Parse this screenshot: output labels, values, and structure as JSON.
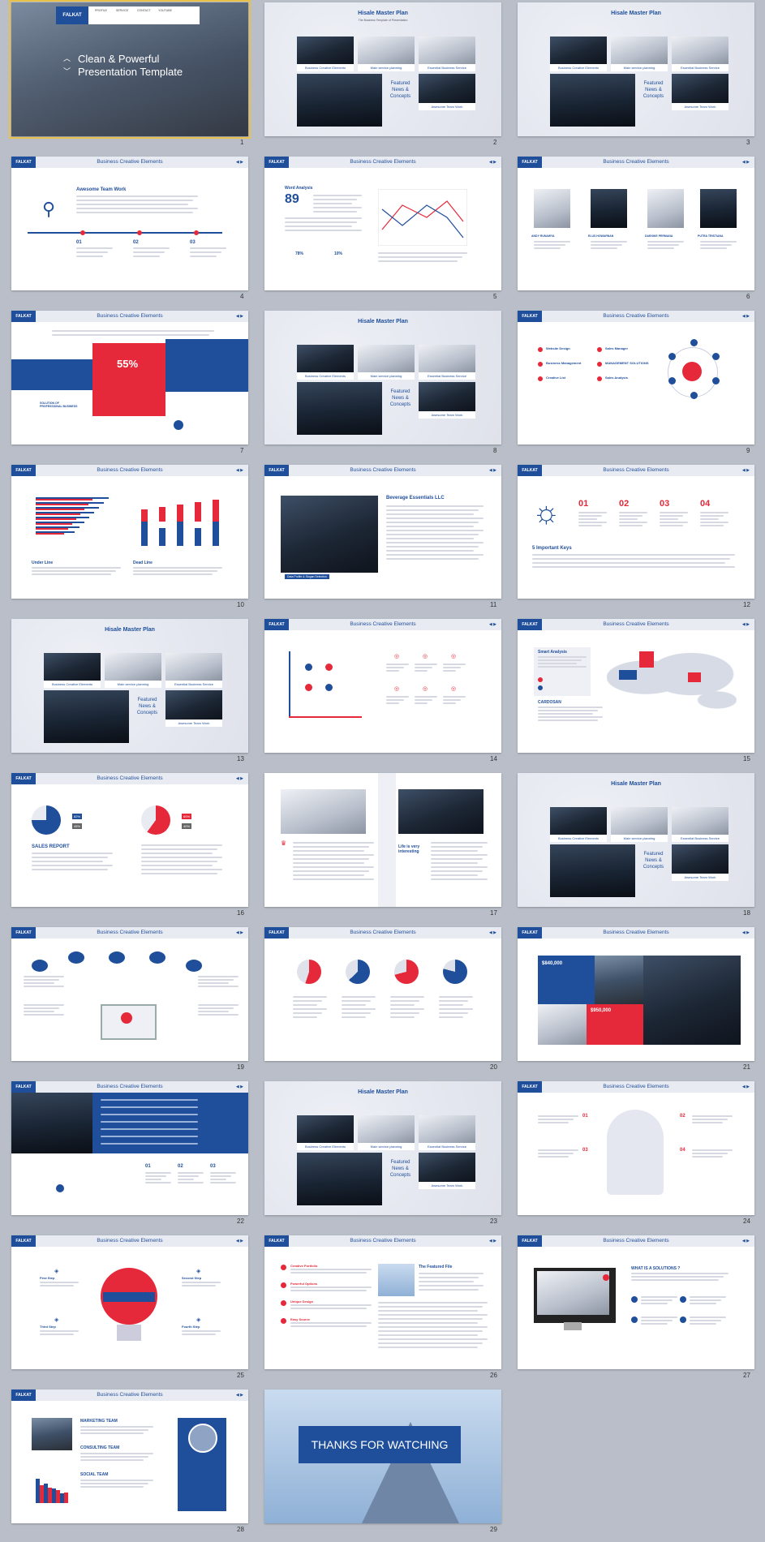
{
  "slides": [
    {
      "number": "1",
      "cover_title": "Clean & Powerful\nPresentation Template",
      "logo": "FALKAT",
      "nav": [
        "PROFILE",
        "SERVICE",
        "CONTACT",
        "YOUTUBE"
      ]
    },
    {
      "number": "2",
      "title": "Hisale Master Plan",
      "subtitle": "The Business Template of Presentation",
      "captions": [
        "Business Creative Elements",
        "Main service planning",
        "Essential Business Service",
        "Awesome Team Work"
      ],
      "featured": "Featured\nNews &\nConcepts"
    },
    {
      "number": "3",
      "title": "Hisale Master Plan",
      "captions": [
        "Business Creative Elements",
        "Main service planning",
        "Essential Business Service",
        "Awesome Team Work"
      ],
      "featured": "Featured\nNews &\nConcepts"
    },
    {
      "number": "4",
      "header": "Business Creative Elements",
      "heading": "Awesome Team Work",
      "steps": [
        "01",
        "02",
        "03"
      ]
    },
    {
      "number": "5",
      "header": "Business Creative Elements",
      "heading": "Word Analysis",
      "big": "89",
      "pct": [
        "78%",
        "10%"
      ]
    },
    {
      "number": "6",
      "header": "Business Creative Elements",
      "names": [
        "ANDY RUNAWYA",
        "ELUS HOWARNAN",
        "DAENIKE PERMANA",
        "PUTRA TRISTIANA"
      ]
    },
    {
      "number": "7",
      "header": "Business Creative Elements",
      "big": "55%",
      "side": "SOLUTION OF PROFESSIONAL BUSINESS"
    },
    {
      "number": "8",
      "title": "Hisale Master Plan",
      "captions": [
        "Business Creative Elements",
        "Main service planning",
        "Essential Business Service",
        "Awesome Team Work"
      ],
      "featured": "Featured\nNews &\nConcepts"
    },
    {
      "number": "9",
      "header": "Business Creative Elements",
      "items": [
        "Website Design",
        "Business Management",
        "Creative List",
        "Sales Manager",
        "MANAGEMENT SOLUTIONS",
        "Sales Analysis"
      ]
    },
    {
      "number": "10",
      "header": "Business Creative Elements",
      "labels": [
        "Under Line",
        "Dead Line"
      ]
    },
    {
      "number": "11",
      "header": "Business Creative Elements",
      "heading": "Beverage Essentials LLC",
      "caption": "Data Profile & Slogan Selection"
    },
    {
      "number": "12",
      "header": "Business Creative Elements",
      "nums": [
        "01",
        "02",
        "03",
        "04"
      ],
      "heading": "5 Important Keys"
    },
    {
      "number": "13",
      "title": "Hisale Master Plan",
      "captions": [
        "Business Creative Elements",
        "Main service planning",
        "Essential Business Service",
        "Awesome Team Work"
      ],
      "featured": "Featured\nNews &\nConcepts"
    },
    {
      "number": "14",
      "header": "Business Creative Elements"
    },
    {
      "number": "15",
      "header": "Business Creative Elements",
      "heading": "Smart Analysis",
      "sub": "CARDOSAN"
    },
    {
      "number": "16",
      "header": "Business Creative Elements",
      "heading": "SALES REPORT",
      "pcts": [
        "82%",
        "45%",
        "60%",
        "40%"
      ]
    },
    {
      "number": "17",
      "side": "Life is very interesting"
    },
    {
      "number": "18",
      "title": "Hisale Master Plan",
      "captions": [
        "Business Creative Elements",
        "Main service planning",
        "Essential Business Service",
        "Awesome Team Work"
      ],
      "featured": "Featured\nNews &\nConcepts"
    },
    {
      "number": "19",
      "header": "Business Creative Elements"
    },
    {
      "number": "20",
      "header": "Business Creative Elements"
    },
    {
      "number": "21",
      "header": "Business Creative Elements",
      "values": [
        "$840,000",
        "$950,000"
      ]
    },
    {
      "number": "22",
      "header": "Business Creative Elements",
      "steps": [
        "01",
        "02",
        "03"
      ]
    },
    {
      "number": "23",
      "title": "Hisale Master Plan",
      "captions": [
        "Business Creative Elements",
        "Main service planning",
        "Essential Business Service",
        "Awesome Team Work"
      ],
      "featured": "Featured\nNews &\nConcepts"
    },
    {
      "number": "24",
      "header": "Business Creative Elements",
      "nums": [
        "01",
        "02",
        "03",
        "04"
      ]
    },
    {
      "number": "25",
      "header": "Business Creative Elements",
      "steps": [
        "First Step",
        "Second Step",
        "Third Step",
        "Fourth Step"
      ]
    },
    {
      "number": "26",
      "header": "Business Creative Elements",
      "heading": "The Featured File",
      "items": [
        "Creative Portfolio",
        "Powerful Options",
        "Unique Design",
        "Easy Source"
      ]
    },
    {
      "number": "27",
      "header": "Business Creative Elements",
      "heading": "WHAT IS A SOLUTIONS ?"
    },
    {
      "number": "28",
      "header": "Business Creative Elements",
      "teams": [
        "MARKETING TEAM",
        "CONSULTING TEAM",
        "SOCIAL TEAM"
      ]
    },
    {
      "number": "29",
      "thanks": "THANKS FOR WATCHING"
    }
  ],
  "colors": {
    "accent": "#1f4e9b",
    "red": "#e6293a",
    "selection": "#e8c14a",
    "background": "#b9bec9"
  }
}
